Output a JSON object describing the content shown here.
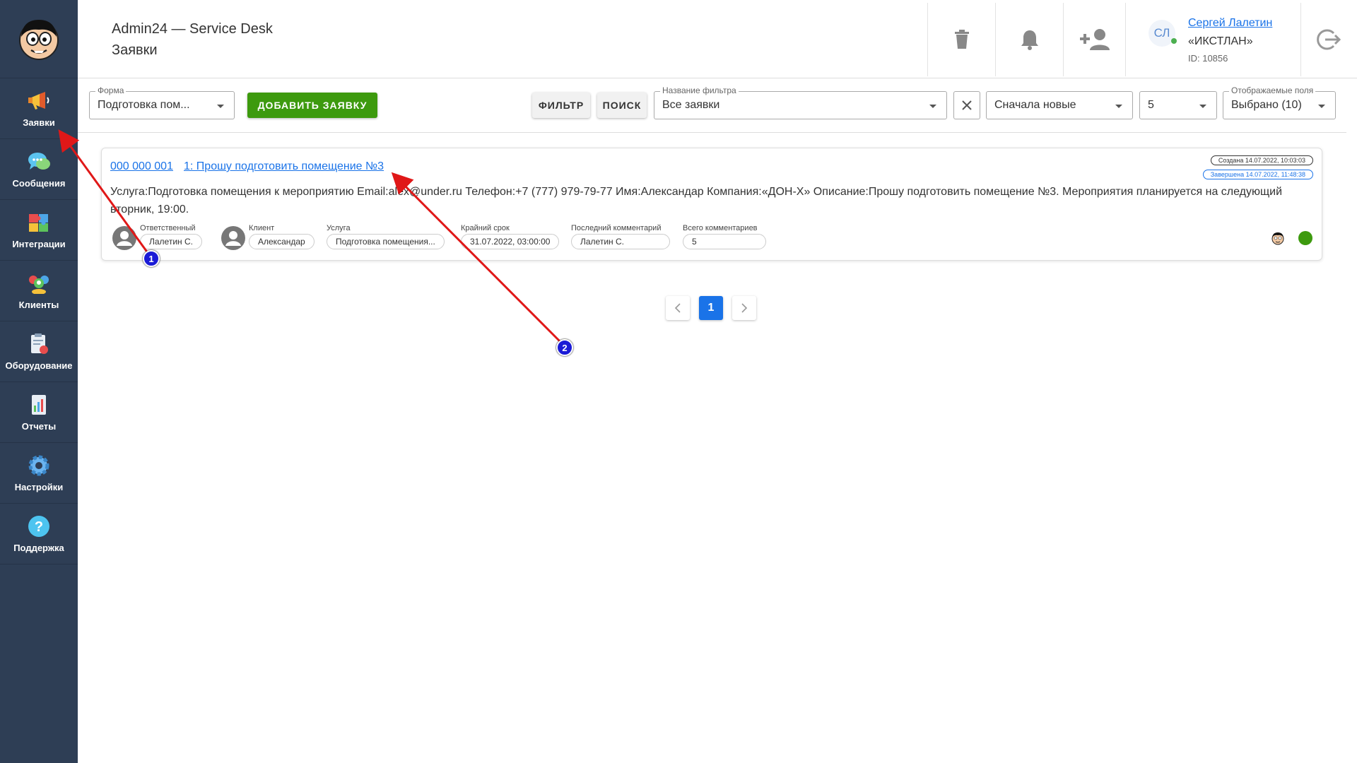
{
  "sidebar": {
    "items": [
      {
        "label": "Заявки",
        "icon": "megaphone-icon"
      },
      {
        "label": "Сообщения",
        "icon": "chat-bubbles-icon"
      },
      {
        "label": "Интеграции",
        "icon": "puzzle-icon"
      },
      {
        "label": "Клиенты",
        "icon": "people-icon"
      },
      {
        "label": "Оборудование",
        "icon": "clipboard-icon"
      },
      {
        "label": "Отчеты",
        "icon": "report-icon"
      },
      {
        "label": "Настройки",
        "icon": "gear-icon"
      },
      {
        "label": "Поддержка",
        "icon": "question-icon"
      }
    ]
  },
  "header": {
    "app_title": "Admin24 — Service Desk",
    "page_title": "Заявки",
    "user": {
      "initials": "СЛ",
      "name": "Сергей Лалетин",
      "org": "«ИКСТЛАН»",
      "id": "ID: 10856"
    }
  },
  "toolbar": {
    "form_label": "Форма",
    "form_value": "Подготовка пом...",
    "add_label": "ДОБАВИТЬ ЗАЯВКУ",
    "filter_label": "ФИЛЬТР",
    "search_label": "ПОИСК",
    "filter_name_label": "Название фильтра",
    "filter_name_value": "Все заявки",
    "sort_value": "Сначала новые",
    "per_page_value": "5",
    "fields_label": "Отображаемые поля",
    "fields_value": "Выбрано (10)"
  },
  "ticket": {
    "number": "000 000 001",
    "title": "1: Прошу подготовить помещение №3",
    "description": "Услуга:Подготовка помещения к мероприятию Email:alex@under.ru Телефон:+7 (777) 979-79-77 Имя:Александар Компания:«ДОН-Х» Описание:Прошу подготовить помещение №3. Мероприятия планируется на следующий вторник, 19:00.",
    "created": "Создана 14.07.2022, 10:03:03",
    "completed": "Завершена 14.07.2022, 11:48:38",
    "fields": {
      "responsible_label": "Ответственный",
      "responsible_value": "Лалетин С.",
      "client_label": "Клиент",
      "client_value": "Александар",
      "service_label": "Услуга",
      "service_value": "Подготовка помещения...",
      "deadline_label": "Крайний срок",
      "deadline_value": "31.07.2022, 03:00:00",
      "last_comment_label": "Последний комментарий",
      "last_comment_value": "Лалетин С.",
      "total_comments_label": "Всего комментариев",
      "total_comments_value": "5"
    },
    "status_color": "#3d9a0e"
  },
  "pagination": {
    "current": "1"
  },
  "annotations": {
    "badge1": "1",
    "badge2": "2",
    "arrow_color": "#e01818"
  }
}
